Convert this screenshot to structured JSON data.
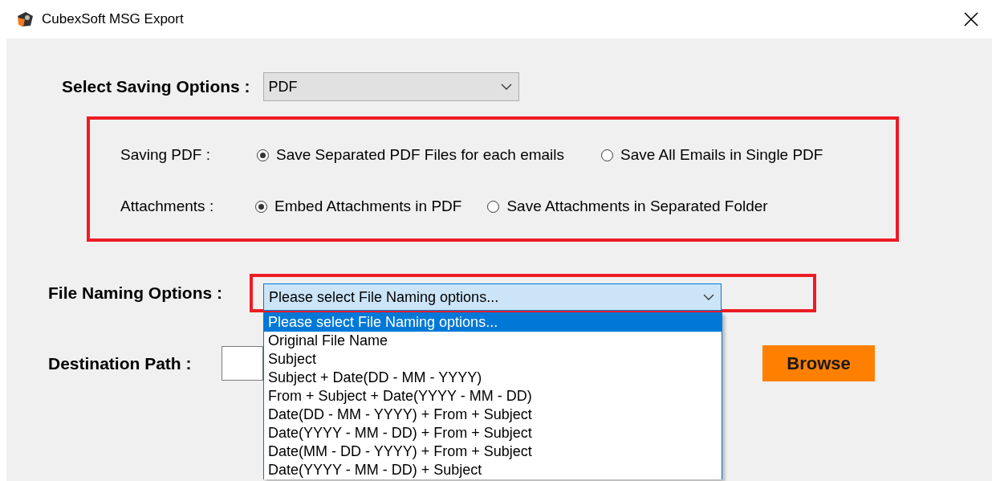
{
  "window": {
    "title": "CubexSoft MSG Export"
  },
  "saving_options": {
    "label": "Select Saving Options :",
    "value": "PDF"
  },
  "pdf_options": [
    {
      "label": "Saving PDF :",
      "choices": [
        {
          "label": "Save Separated PDF Files for each emails",
          "selected": true
        },
        {
          "label": "Save All Emails in Single PDF",
          "selected": false
        }
      ]
    },
    {
      "label": "Attachments :",
      "choices": [
        {
          "label": "Embed Attachments in PDF",
          "selected": true
        },
        {
          "label": "Save Attachments in Separated Folder",
          "selected": false
        }
      ]
    }
  ],
  "file_naming": {
    "label": "File Naming Options :",
    "value": "Please select File Naming options...",
    "expanded": true,
    "options": [
      {
        "label": "Please select File Naming options...",
        "selected": true
      },
      {
        "label": "Original File Name",
        "selected": false
      },
      {
        "label": "Subject",
        "selected": false
      },
      {
        "label": "Subject + Date(DD - MM - YYYY)",
        "selected": false
      },
      {
        "label": "From + Subject + Date(YYYY - MM - DD)",
        "selected": false
      },
      {
        "label": "Date(DD - MM - YYYY) + From + Subject",
        "selected": false
      },
      {
        "label": "Date(YYYY - MM - DD) + From + Subject",
        "selected": false
      },
      {
        "label": "Date(MM - DD - YYYY) + From + Subject",
        "selected": false
      },
      {
        "label": "Date(YYYY - MM - DD) + Subject",
        "selected": false
      }
    ]
  },
  "destination": {
    "label": "Destination Path :"
  },
  "browse_button": "Browse"
}
